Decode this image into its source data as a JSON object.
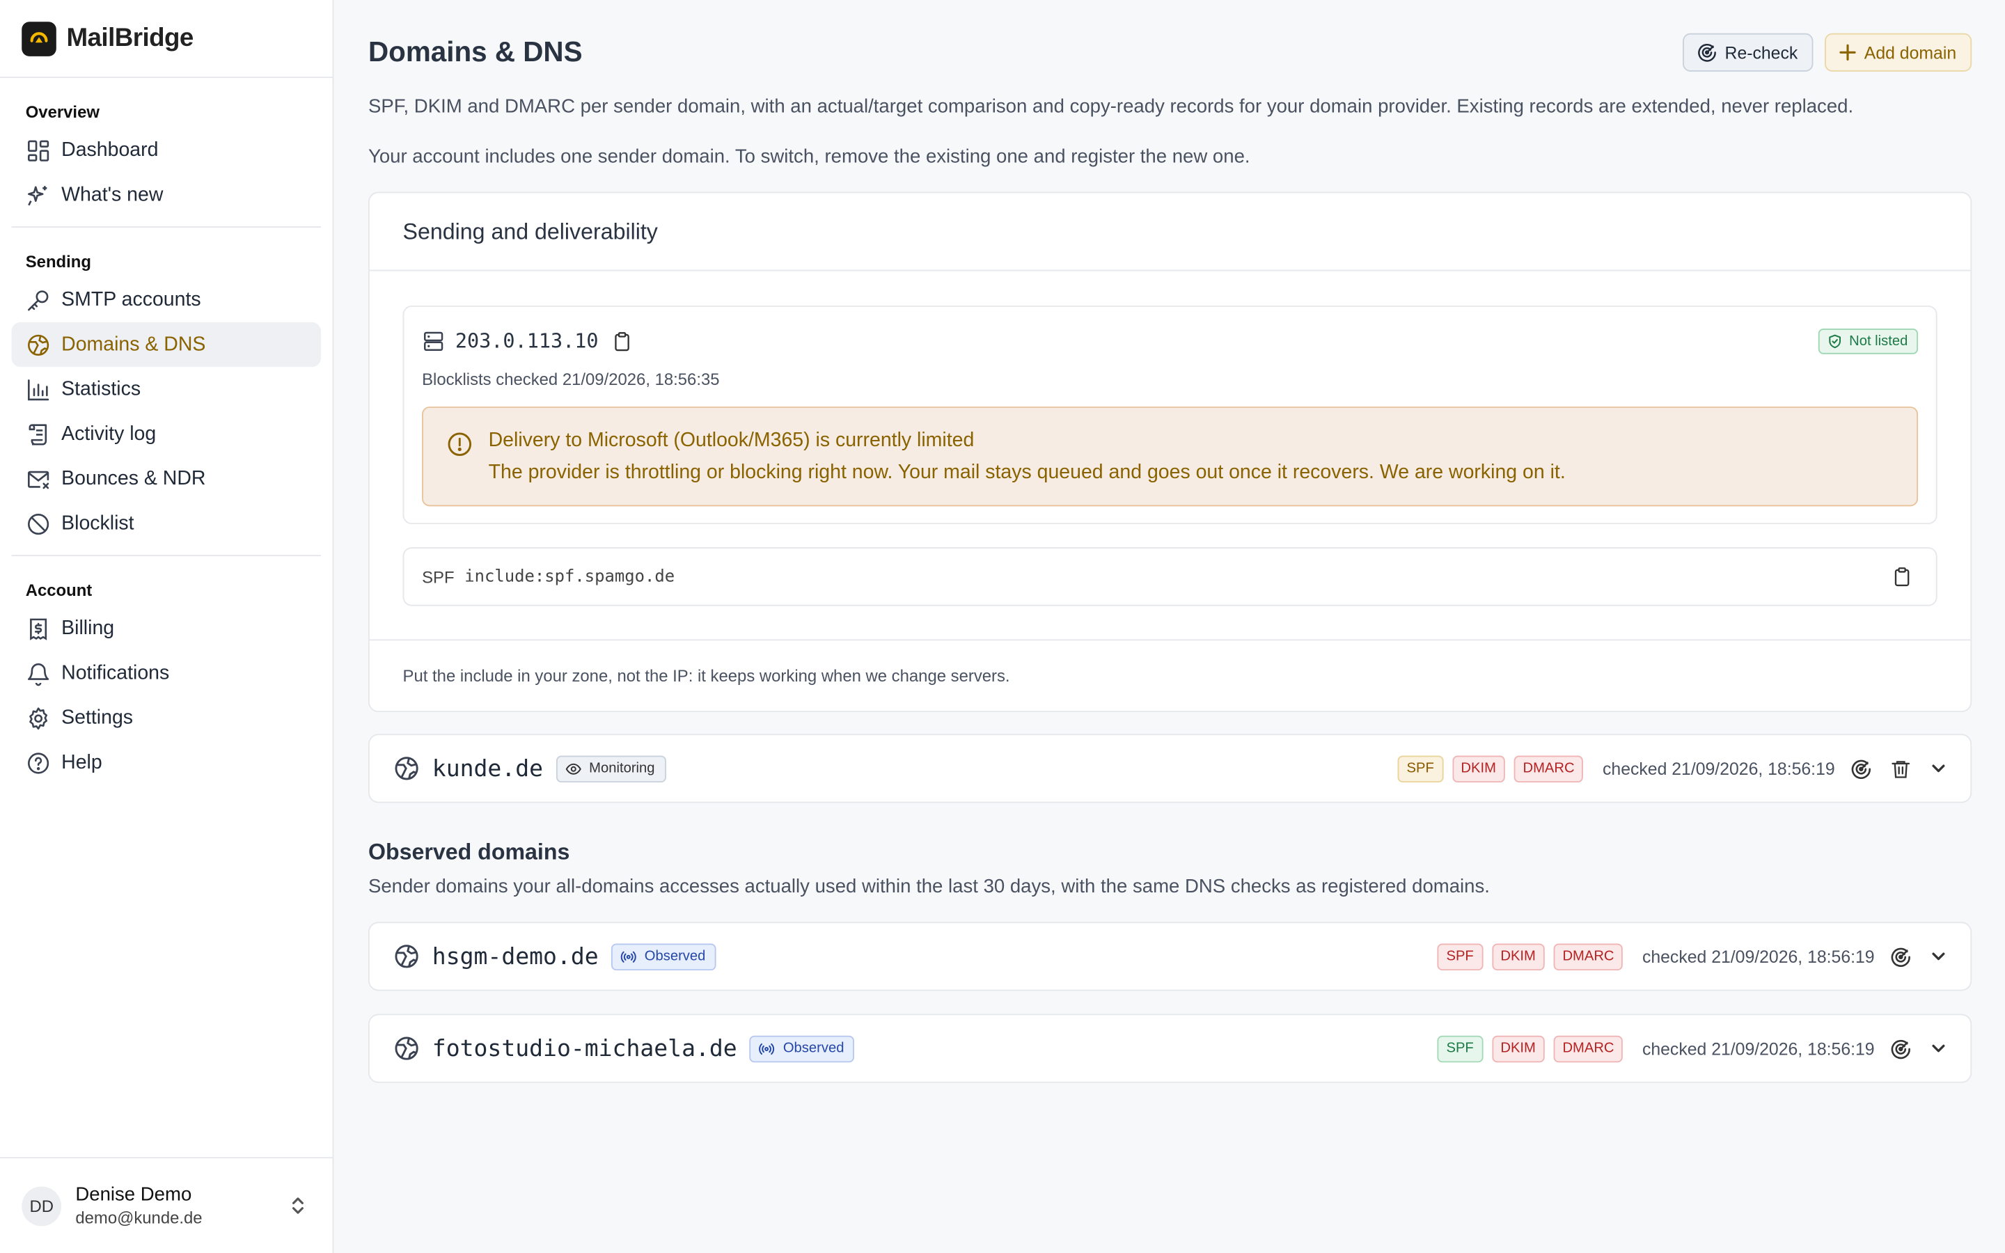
{
  "app": {
    "name": "MailBridge"
  },
  "sidebar": {
    "groups": [
      {
        "title": "Overview",
        "items": [
          {
            "label": "Dashboard",
            "icon": "dashboard-icon"
          },
          {
            "label": "What's new",
            "icon": "sparkles-icon"
          }
        ]
      },
      {
        "title": "Sending",
        "items": [
          {
            "label": "SMTP accounts",
            "icon": "key-icon"
          },
          {
            "label": "Domains & DNS",
            "icon": "globe-icon",
            "active": true
          },
          {
            "label": "Statistics",
            "icon": "bar-chart-icon"
          },
          {
            "label": "Activity log",
            "icon": "scroll-icon"
          },
          {
            "label": "Bounces & NDR",
            "icon": "mail-x-icon"
          },
          {
            "label": "Blocklist",
            "icon": "ban-icon"
          }
        ]
      },
      {
        "title": "Account",
        "items": [
          {
            "label": "Billing",
            "icon": "receipt-icon"
          },
          {
            "label": "Notifications",
            "icon": "bell-icon"
          },
          {
            "label": "Settings",
            "icon": "gear-icon"
          },
          {
            "label": "Help",
            "icon": "help-icon"
          }
        ]
      }
    ],
    "user": {
      "initials": "DD",
      "name": "Denise Demo",
      "email": "demo@kunde.de"
    }
  },
  "header": {
    "title": "Domains & DNS",
    "recheck_label": "Re-check",
    "add_label": "Add domain"
  },
  "intro": {
    "line1": "SPF, DKIM and DMARC per sender domain, with an actual/target comparison and copy-ready records for your domain provider. Existing records are extended, never replaced.",
    "line2": "Your account includes one sender domain. To switch, remove the existing one and register the new one."
  },
  "deliverability": {
    "title": "Sending and deliverability",
    "ip": "203.0.113.10",
    "listing_badge": "Not listed",
    "checked": "Blocklists checked 21/09/2026, 18:56:35",
    "alert_title": "Delivery to Microsoft (Outlook/M365) is currently limited",
    "alert_text": "The provider is throttling or blocking right now. Your mail stays queued and goes out once it recovers. We are working on it.",
    "spf_label": "SPF",
    "spf_value": "include:spf.spamgo.de",
    "footer": "Put the include in your zone, not the IP: it keeps working when we change servers."
  },
  "domains": [
    {
      "name": "kunde.de",
      "tag": "Monitoring",
      "spf": "SPF",
      "dkim": "DKIM",
      "dmarc": "DMARC",
      "spf_status": "warn",
      "dkim_status": "error",
      "dmarc_status": "error",
      "checked": "checked 21/09/2026, 18:56:19"
    }
  ],
  "observed": {
    "title": "Observed domains",
    "subtitle": "Sender domains your all-domains accesses actually used within the last 30 days, with the same DNS checks as registered domains.",
    "items": [
      {
        "name": "hsgm-demo.de",
        "tag": "Observed",
        "spf": "SPF",
        "dkim": "DKIM",
        "dmarc": "DMARC",
        "spf_status": "error",
        "dkim_status": "error",
        "dmarc_status": "error",
        "checked": "checked 21/09/2026, 18:56:19"
      },
      {
        "name": "fotostudio-michaela.de",
        "tag": "Observed",
        "spf": "SPF",
        "dkim": "DKIM",
        "dmarc": "DMARC",
        "spf_status": "ok",
        "dkim_status": "error",
        "dmarc_status": "error",
        "checked": "checked 21/09/2026, 18:56:19"
      }
    ]
  },
  "colors": {
    "accent": "#8a6300",
    "warning_bg": "#f6ece3",
    "ok": "#1d7a45",
    "error": "#b42323"
  }
}
